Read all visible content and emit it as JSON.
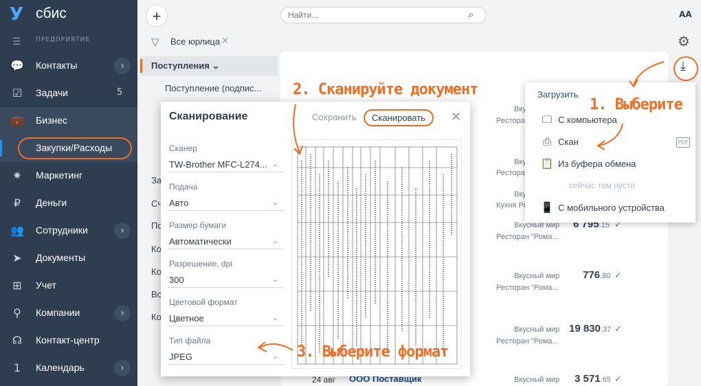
{
  "brand": {
    "logo_glyph": "У",
    "name": "сбис",
    "org_label": "ПРЕДПРИЯТИЕ"
  },
  "sidebar": {
    "items": [
      {
        "label": "Контакты",
        "icon": "chat-icon",
        "glyph": "💬",
        "chevron": "›"
      },
      {
        "label": "Задачи",
        "icon": "tasks-icon",
        "glyph": "☑",
        "count": "5"
      },
      {
        "label": "Бизнес",
        "icon": "briefcase-icon",
        "glyph": "💼"
      },
      {
        "label": "Маркетинг",
        "icon": "star-icon",
        "glyph": "✷"
      },
      {
        "label": "Деньги",
        "icon": "money-icon",
        "glyph": "₽"
      },
      {
        "label": "Сотрудники",
        "icon": "people-icon",
        "glyph": "👥",
        "chevron": "›"
      },
      {
        "label": "Документы",
        "icon": "send-icon",
        "glyph": "➤"
      },
      {
        "label": "Учет",
        "icon": "accounting-icon",
        "glyph": "⊞"
      },
      {
        "label": "Компании",
        "icon": "location-icon",
        "glyph": "⚲",
        "chevron": "›"
      },
      {
        "label": "Контакт-центр",
        "icon": "headset-icon",
        "glyph": "☊"
      },
      {
        "label": "Календарь",
        "icon": "calendar-icon",
        "glyph": "1",
        "chevron": "›"
      }
    ],
    "sub_item": "Закупки/Расходы"
  },
  "toolbar": {
    "add": "+",
    "search_placeholder": "Найти...",
    "search_glyph": "⌕",
    "font_size_toggle": "AA",
    "gear_glyph": "⚙"
  },
  "filter": {
    "label": "Все юрлица",
    "clear": "×",
    "glyph": "▽"
  },
  "left_list": {
    "section": "Поступления",
    "section_chevron": "⌄",
    "sub": "Поступление (подпис...",
    "cut_items": [
      "За",
      "Сч",
      "По",
      "Ко",
      "Ко",
      "Во",
      "Ко"
    ]
  },
  "rows": [
    {
      "org": "Вкусный мир",
      "sub": "Ресторан \"Рома..."
    },
    {
      "org": "Вкусный мир",
      "sub": "Ресторан \"Рома..."
    },
    {
      "org": "Вкусный мир",
      "sub": "Кухня Ресторан..."
    },
    {
      "org": "Вкусный мир",
      "sub": "Ресторан \"Рома...",
      "amount_int": "6 795",
      "amount_dec": ".15"
    },
    {
      "org": "Вкусный мир",
      "sub": "Ресторан \"Рома...",
      "amount_int": "776",
      "amount_dec": ".80"
    },
    {
      "org": "Вкусный мир",
      "sub": "Ресторан \"Рома...",
      "amount_int": "19 830",
      "amount_dec": ".37"
    },
    {
      "org": "Вкусный мир",
      "amount_int": "3 571",
      "amount_dec": ".65"
    }
  ],
  "check_glyph": "✓",
  "last_row": {
    "date": "24 авг",
    "name": "ООО Поставщик"
  },
  "download": {
    "glyph": "⤓"
  },
  "dropdown": {
    "title": "Загрузить",
    "items": [
      {
        "label": "С компьютера",
        "icon": "monitor-icon",
        "glyph": "🖵"
      },
      {
        "label": "Скан",
        "icon": "scanner-icon",
        "glyph": "⎙"
      },
      {
        "label": "Из буфера обмена",
        "icon": "clipboard-icon",
        "glyph": "📋"
      },
      {
        "label": "С мобильного устройства",
        "icon": "phone-icon",
        "glyph": "📱"
      }
    ],
    "pdf_badge": "PDF",
    "empty_note": "сейчас там пусто"
  },
  "dialog": {
    "title": "Сканирование",
    "save": "Сохранить",
    "scan": "Сканировать",
    "close": "✕",
    "fields": [
      {
        "label": "Сканер",
        "value": "TW-Brother MFC-L274..."
      },
      {
        "label": "Подача",
        "value": "Авто"
      },
      {
        "label": "Размер бумаги",
        "value": "Автоматически"
      },
      {
        "label": "Разрешение, dpi",
        "value": "300"
      },
      {
        "label": "Цветовой формат",
        "value": "Цветное"
      },
      {
        "label": "Тип файла",
        "value": "JPEG"
      }
    ],
    "field_chevron": "⌄"
  },
  "annotations": {
    "step1": "1. Выберите",
    "step2": "2. Сканируйте документ",
    "step3": "3. Выберите формат"
  },
  "accent_color": "#f26c22"
}
